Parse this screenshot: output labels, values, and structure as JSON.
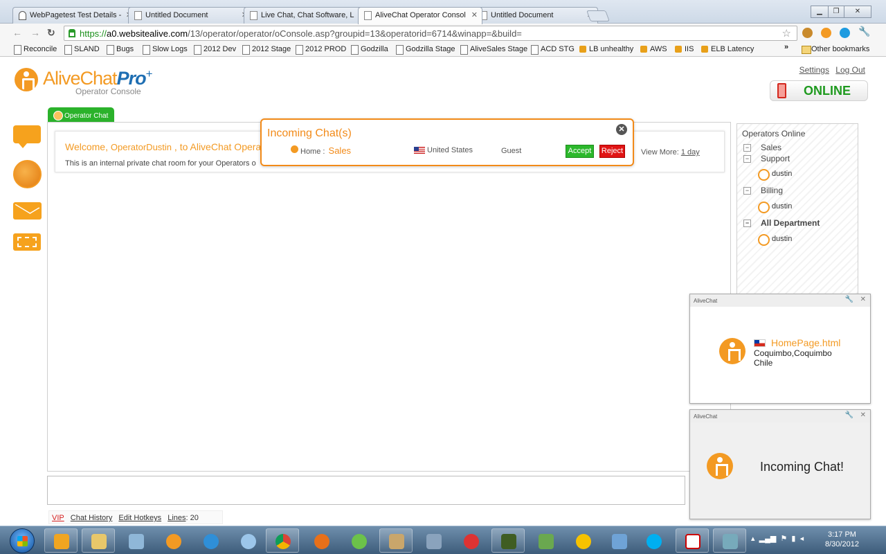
{
  "browser": {
    "tabs": [
      {
        "label": "WebPagetest Test Details -"
      },
      {
        "label": "Untitled Document"
      },
      {
        "label": "Live Chat, Chat Software, L"
      },
      {
        "label": "AliveChat Operator Consol"
      },
      {
        "label": "Untitled Document"
      }
    ],
    "url_scheme": "https://",
    "url_host": "a0.websitealive.com",
    "url_path": "/13/operator/operator/oConsole.asp?groupid=13&operatorid=6714&winapp=&build=",
    "bookmarks": [
      "Reconcile",
      "SLAND",
      "Bugs",
      "Slow Logs",
      "2012 Dev",
      "2012 Stage",
      "2012 PROD",
      "Godzilla",
      "Godzilla Stage",
      "AliveSales Stage",
      "ACD STG",
      "LB unhealthy",
      "AWS",
      "IIS",
      "ELB Latency"
    ],
    "other_bookmarks": "Other bookmarks",
    "bookmarks_overflow": "»"
  },
  "app": {
    "brand_main": "AliveChat",
    "brand_pro": "Pro",
    "brand_plus": "+",
    "brand_sub": "Operator Console",
    "settings_link": "Settings",
    "logout_link": "Log Out",
    "status": "ONLINE",
    "chat_tab": "Operator Chat",
    "welcome_prefix": "Welcome,",
    "welcome_name": "OperatorDustin",
    "welcome_suffix": ", to AliveChat Opera",
    "welcome_desc": "This is an internal private chat room for your Operators o",
    "view_more_label": "View More:",
    "view_more_link": "1 day",
    "bottom_links": {
      "vip": "VIP",
      "chat_history": "Chat History",
      "edit_hotkeys": "Edit Hotkeys",
      "lines_label": "Lines",
      "lines_value": ": 20"
    }
  },
  "operators": {
    "title": "Operators Online",
    "departments": [
      {
        "name": "Sales",
        "operators": []
      },
      {
        "name": "Support",
        "operators": [
          "dustin"
        ]
      },
      {
        "name": "Billing",
        "operators": [
          "dustin"
        ]
      },
      {
        "name": "All Department",
        "operators": [
          "dustin"
        ]
      }
    ]
  },
  "incoming": {
    "title": "Incoming Chat(s)",
    "home_label": "Home :",
    "department": "Sales",
    "country": "United States",
    "visitor": "Guest",
    "accept": "Accept",
    "reject": "Reject"
  },
  "notifications": [
    {
      "app": "AliveChat",
      "page": "HomePage.html",
      "location": "Coquimbo,Coquimbo",
      "country": "Chile"
    },
    {
      "app": "AliveChat",
      "message": "Incoming Chat!"
    }
  ],
  "taskbar": {
    "time": "3:17 PM",
    "date": "8/30/2012"
  },
  "colors": {
    "brand_orange": "#f39a23",
    "brand_blue": "#1f6fb3",
    "online_green": "#1f9a1f",
    "accept_green": "#2cb82c",
    "reject_red": "#e01515"
  }
}
